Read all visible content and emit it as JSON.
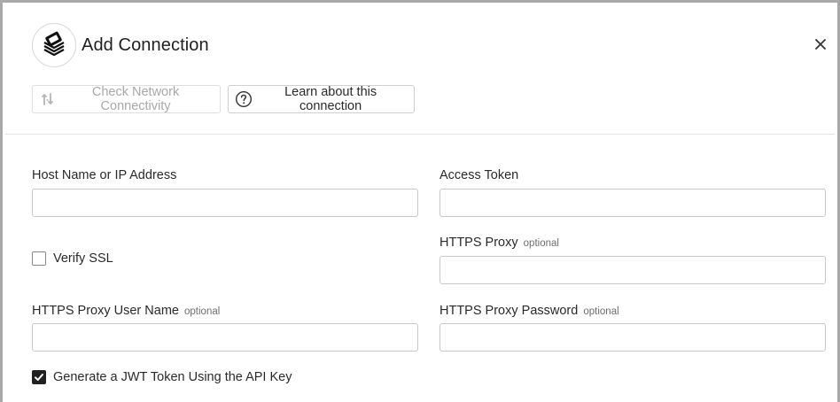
{
  "dialog": {
    "title": "Add Connection",
    "close_label": "×"
  },
  "toolbar": {
    "check_network_label": "Check Network Connectivity",
    "learn_label": "Learn about this connection"
  },
  "form": {
    "host": {
      "label": "Host Name or IP Address",
      "value": ""
    },
    "access_token": {
      "label": "Access Token",
      "value": ""
    },
    "verify_ssl": {
      "label": "Verify SSL",
      "checked": false
    },
    "https_proxy": {
      "label": "HTTPS Proxy",
      "optional": "optional",
      "value": ""
    },
    "proxy_user": {
      "label": "HTTPS Proxy User Name",
      "optional": "optional",
      "value": ""
    },
    "proxy_password": {
      "label": "HTTPS Proxy Password",
      "optional": "optional",
      "value": ""
    },
    "generate_jwt": {
      "label": "Generate a JWT Token Using the API Key",
      "checked": true
    }
  },
  "colors": {
    "frame_border": "#a9a9a9",
    "disabled_text": "#a8a8a8",
    "checkbox_checked": "#202020"
  }
}
